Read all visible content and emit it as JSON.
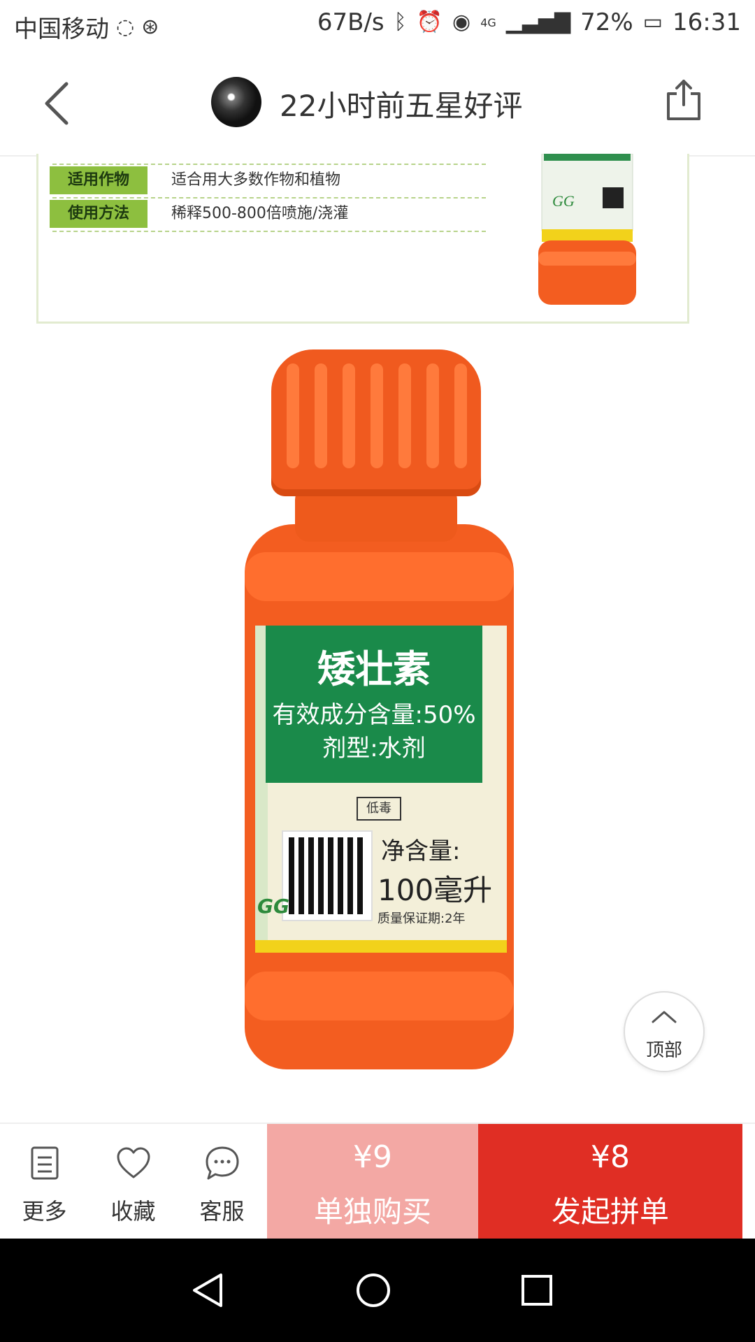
{
  "status_bar": {
    "carrier": "中国移动",
    "speed": "67B/s",
    "network": "4G",
    "battery": "72%",
    "time": "16:31"
  },
  "header": {
    "title": "22小时前五星好评"
  },
  "banner": {
    "rows": [
      {
        "tag": "适用作物",
        "text": "适合用大多数作物和植物"
      },
      {
        "tag": "使用方法",
        "text": "稀释500-800倍喷施/浇灌"
      }
    ]
  },
  "product_label": {
    "name": "矮壮素",
    "ingredient": "有效成分含量:50%",
    "form": "剂型:水剂",
    "toxicity": "低毒",
    "net_title": "净含量:",
    "net_value": "100毫升",
    "shelf_life": "质量保证期:2年",
    "logo": "GG"
  },
  "back_to_top": {
    "label": "顶部"
  },
  "action_bar": {
    "more_label": "更多",
    "favorite_label": "收藏",
    "service_label": "客服",
    "solo_price": "¥9",
    "solo_label": "单独购买",
    "group_price": "¥8",
    "group_label": "发起拼单"
  },
  "colors": {
    "solo_bg": "#f3a8a4",
    "group_bg": "#e02e24",
    "bottle": "#f35d20",
    "label_green": "#1a8a4a"
  }
}
